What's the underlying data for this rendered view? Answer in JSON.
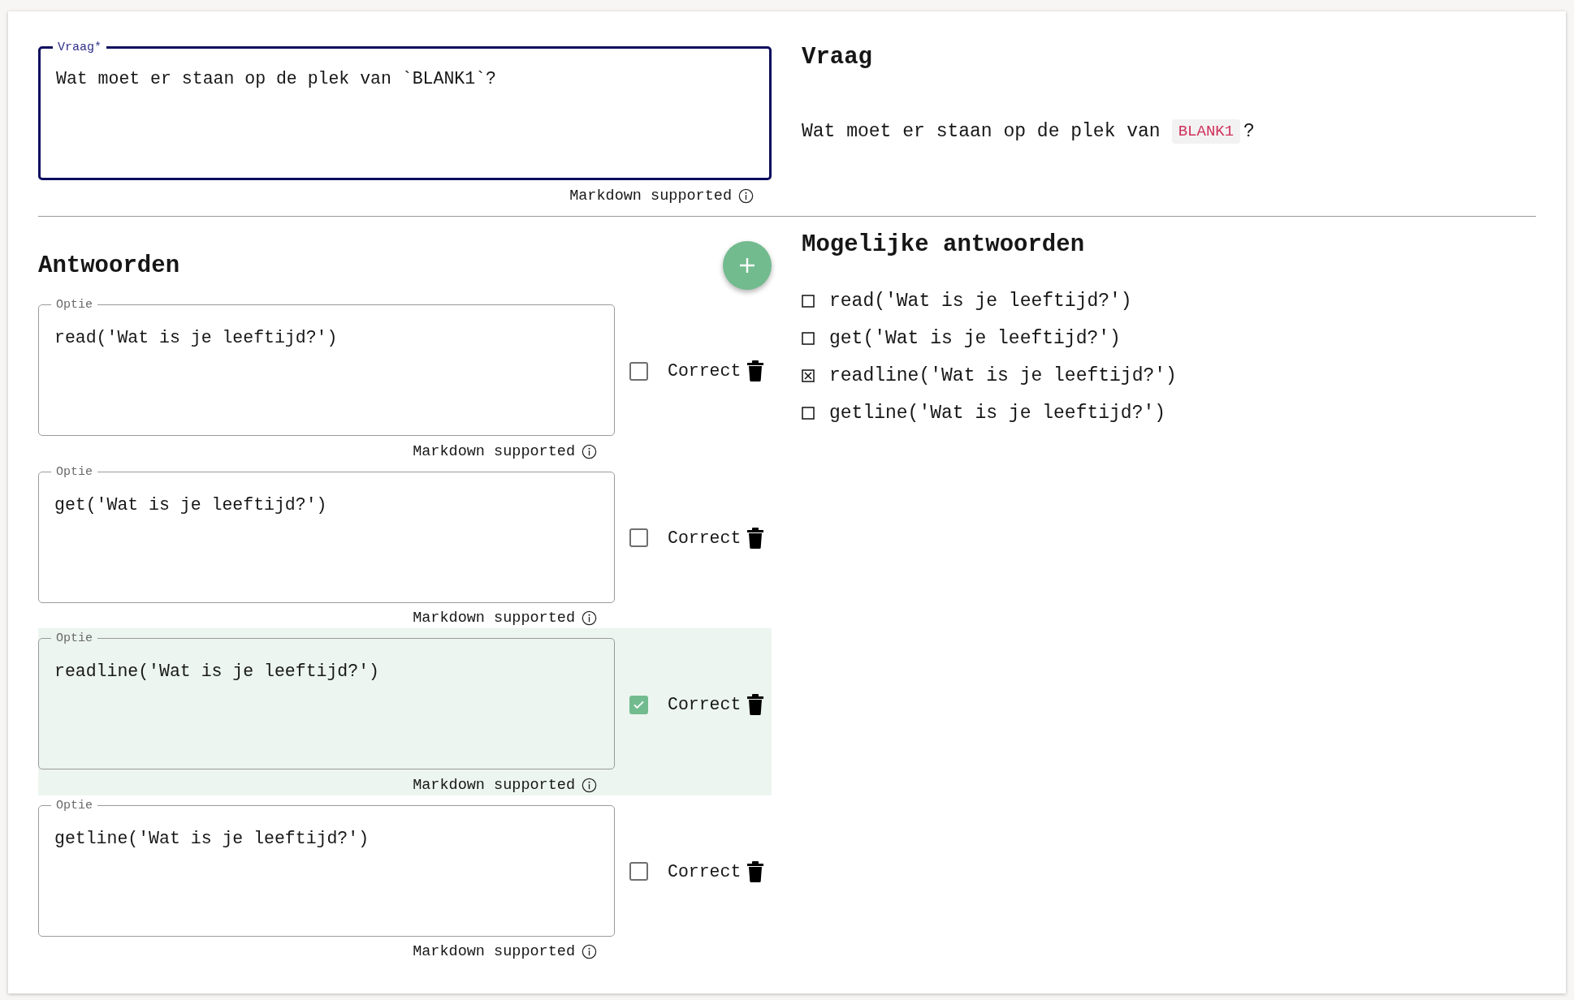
{
  "question_field": {
    "label": "Vraag*",
    "value": "Wat moet er staan op de plek van `BLANK1`?",
    "focused": true,
    "hint": "Markdown supported"
  },
  "preview": {
    "title": "Vraag",
    "parts": [
      {
        "kind": "text",
        "text": "Wat moet er staan op de plek van"
      },
      {
        "kind": "code",
        "text": "BLANK1"
      },
      {
        "kind": "text",
        "text": "?"
      }
    ]
  },
  "answers": {
    "title": "Antwoorden",
    "options": [
      {
        "label": "Optie",
        "value": "read('Wat is je leeftijd?')",
        "correct": false,
        "correct_label": "Correct",
        "hint": "Markdown supported"
      },
      {
        "label": "Optie",
        "value": "get('Wat is je leeftijd?')",
        "correct": false,
        "correct_label": "Correct",
        "hint": "Markdown supported"
      },
      {
        "label": "Optie",
        "value": "readline('Wat is je leeftijd?')",
        "correct": true,
        "correct_label": "Correct",
        "hint": "Markdown supported"
      },
      {
        "label": "Optie",
        "value": "getline('Wat is je leeftijd?')",
        "correct": false,
        "correct_label": "Correct",
        "hint": "Markdown supported"
      }
    ]
  },
  "possible_answers": {
    "title": "Mogelijke antwoorden",
    "items": [
      {
        "text": "read('Wat is je leeftijd?')",
        "checked": false
      },
      {
        "text": "get('Wat is je leeftijd?')",
        "checked": false
      },
      {
        "text": "readline('Wat is je leeftijd?')",
        "checked": true
      },
      {
        "text": "getline('Wat is je leeftijd?')",
        "checked": false
      }
    ]
  }
}
